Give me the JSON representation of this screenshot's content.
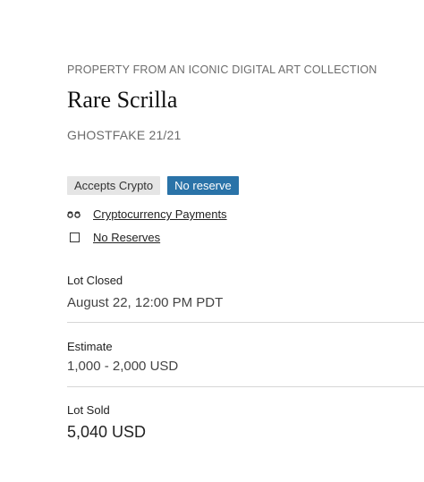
{
  "lot": {
    "eyebrow": "PROPERTY FROM AN ICONIC DIGITAL ART COLLECTION",
    "title": "Rare Scrilla",
    "subtitle": "GHOSTFAKE 21/21"
  },
  "badges": {
    "crypto": "Accepts Crypto",
    "reserve": "No reserve"
  },
  "links": {
    "crypto_payments": "Cryptocurrency Payments",
    "no_reserves": "No Reserves"
  },
  "details": {
    "closed_label": "Lot Closed",
    "closed_value": "August 22, 12:00 PM PDT",
    "estimate_label": "Estimate",
    "estimate_value": "1,000 - 2,000 USD",
    "sold_label": "Lot Sold",
    "sold_value": "5,040 USD"
  },
  "colors": {
    "accent_blue": "#2a73a8",
    "badge_grey": "#e5e5e5",
    "divider": "#d6d6d6"
  },
  "icons": {
    "crypto": "glasses-icon",
    "reserve": "square-icon"
  }
}
